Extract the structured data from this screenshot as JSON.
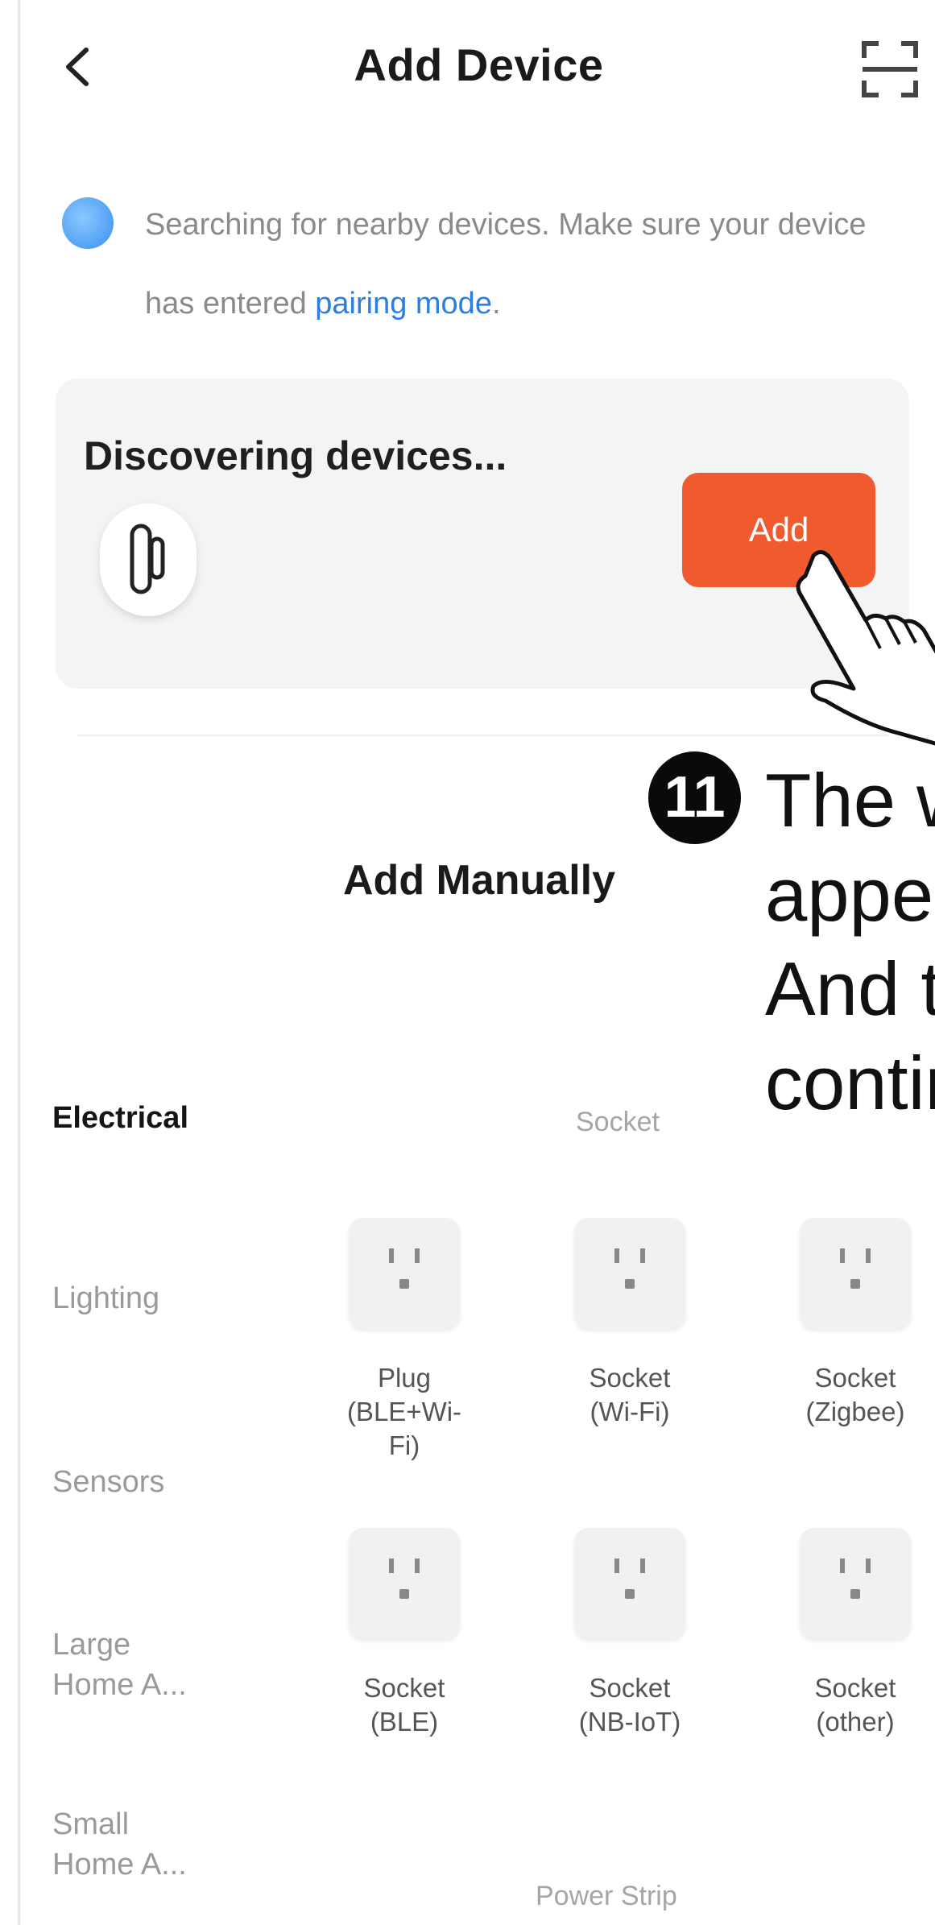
{
  "header": {
    "title": "Add Device"
  },
  "notice": {
    "text": "Searching for nearby devices. Make sure your device has entered ",
    "link": "pairing mode",
    "suffix": "."
  },
  "discover": {
    "title": "Discovering devices...",
    "add_label": "Add"
  },
  "annotation": {
    "step": "11",
    "lines": [
      "The w",
      "appe",
      "And t",
      "contin"
    ]
  },
  "manual": {
    "title": "Add Manually"
  },
  "categories": [
    "Electrical",
    "Lighting",
    "Sensors",
    "Large Home A...",
    "Small Home A..."
  ],
  "groups": {
    "socket": "Socket",
    "power_strip": "Power Strip"
  },
  "products": [
    {
      "name": "Plug\n(BLE+Wi-Fi)"
    },
    {
      "name": "Socket\n(Wi-Fi)"
    },
    {
      "name": "Socket\n(Zigbee)"
    },
    {
      "name": "Socket\n(BLE)"
    },
    {
      "name": "Socket\n(NB-IoT)"
    },
    {
      "name": "Socket\n(other)"
    }
  ],
  "colors": {
    "accent": "#ef5a2e",
    "link": "#2b7fe0"
  },
  "icons": {
    "back": "chevron-left-icon",
    "scan": "scan-icon",
    "info": "bluetooth-search-icon",
    "device": "door-sensor-icon",
    "socket": "socket-icon",
    "hand": "pointing-hand-icon"
  }
}
